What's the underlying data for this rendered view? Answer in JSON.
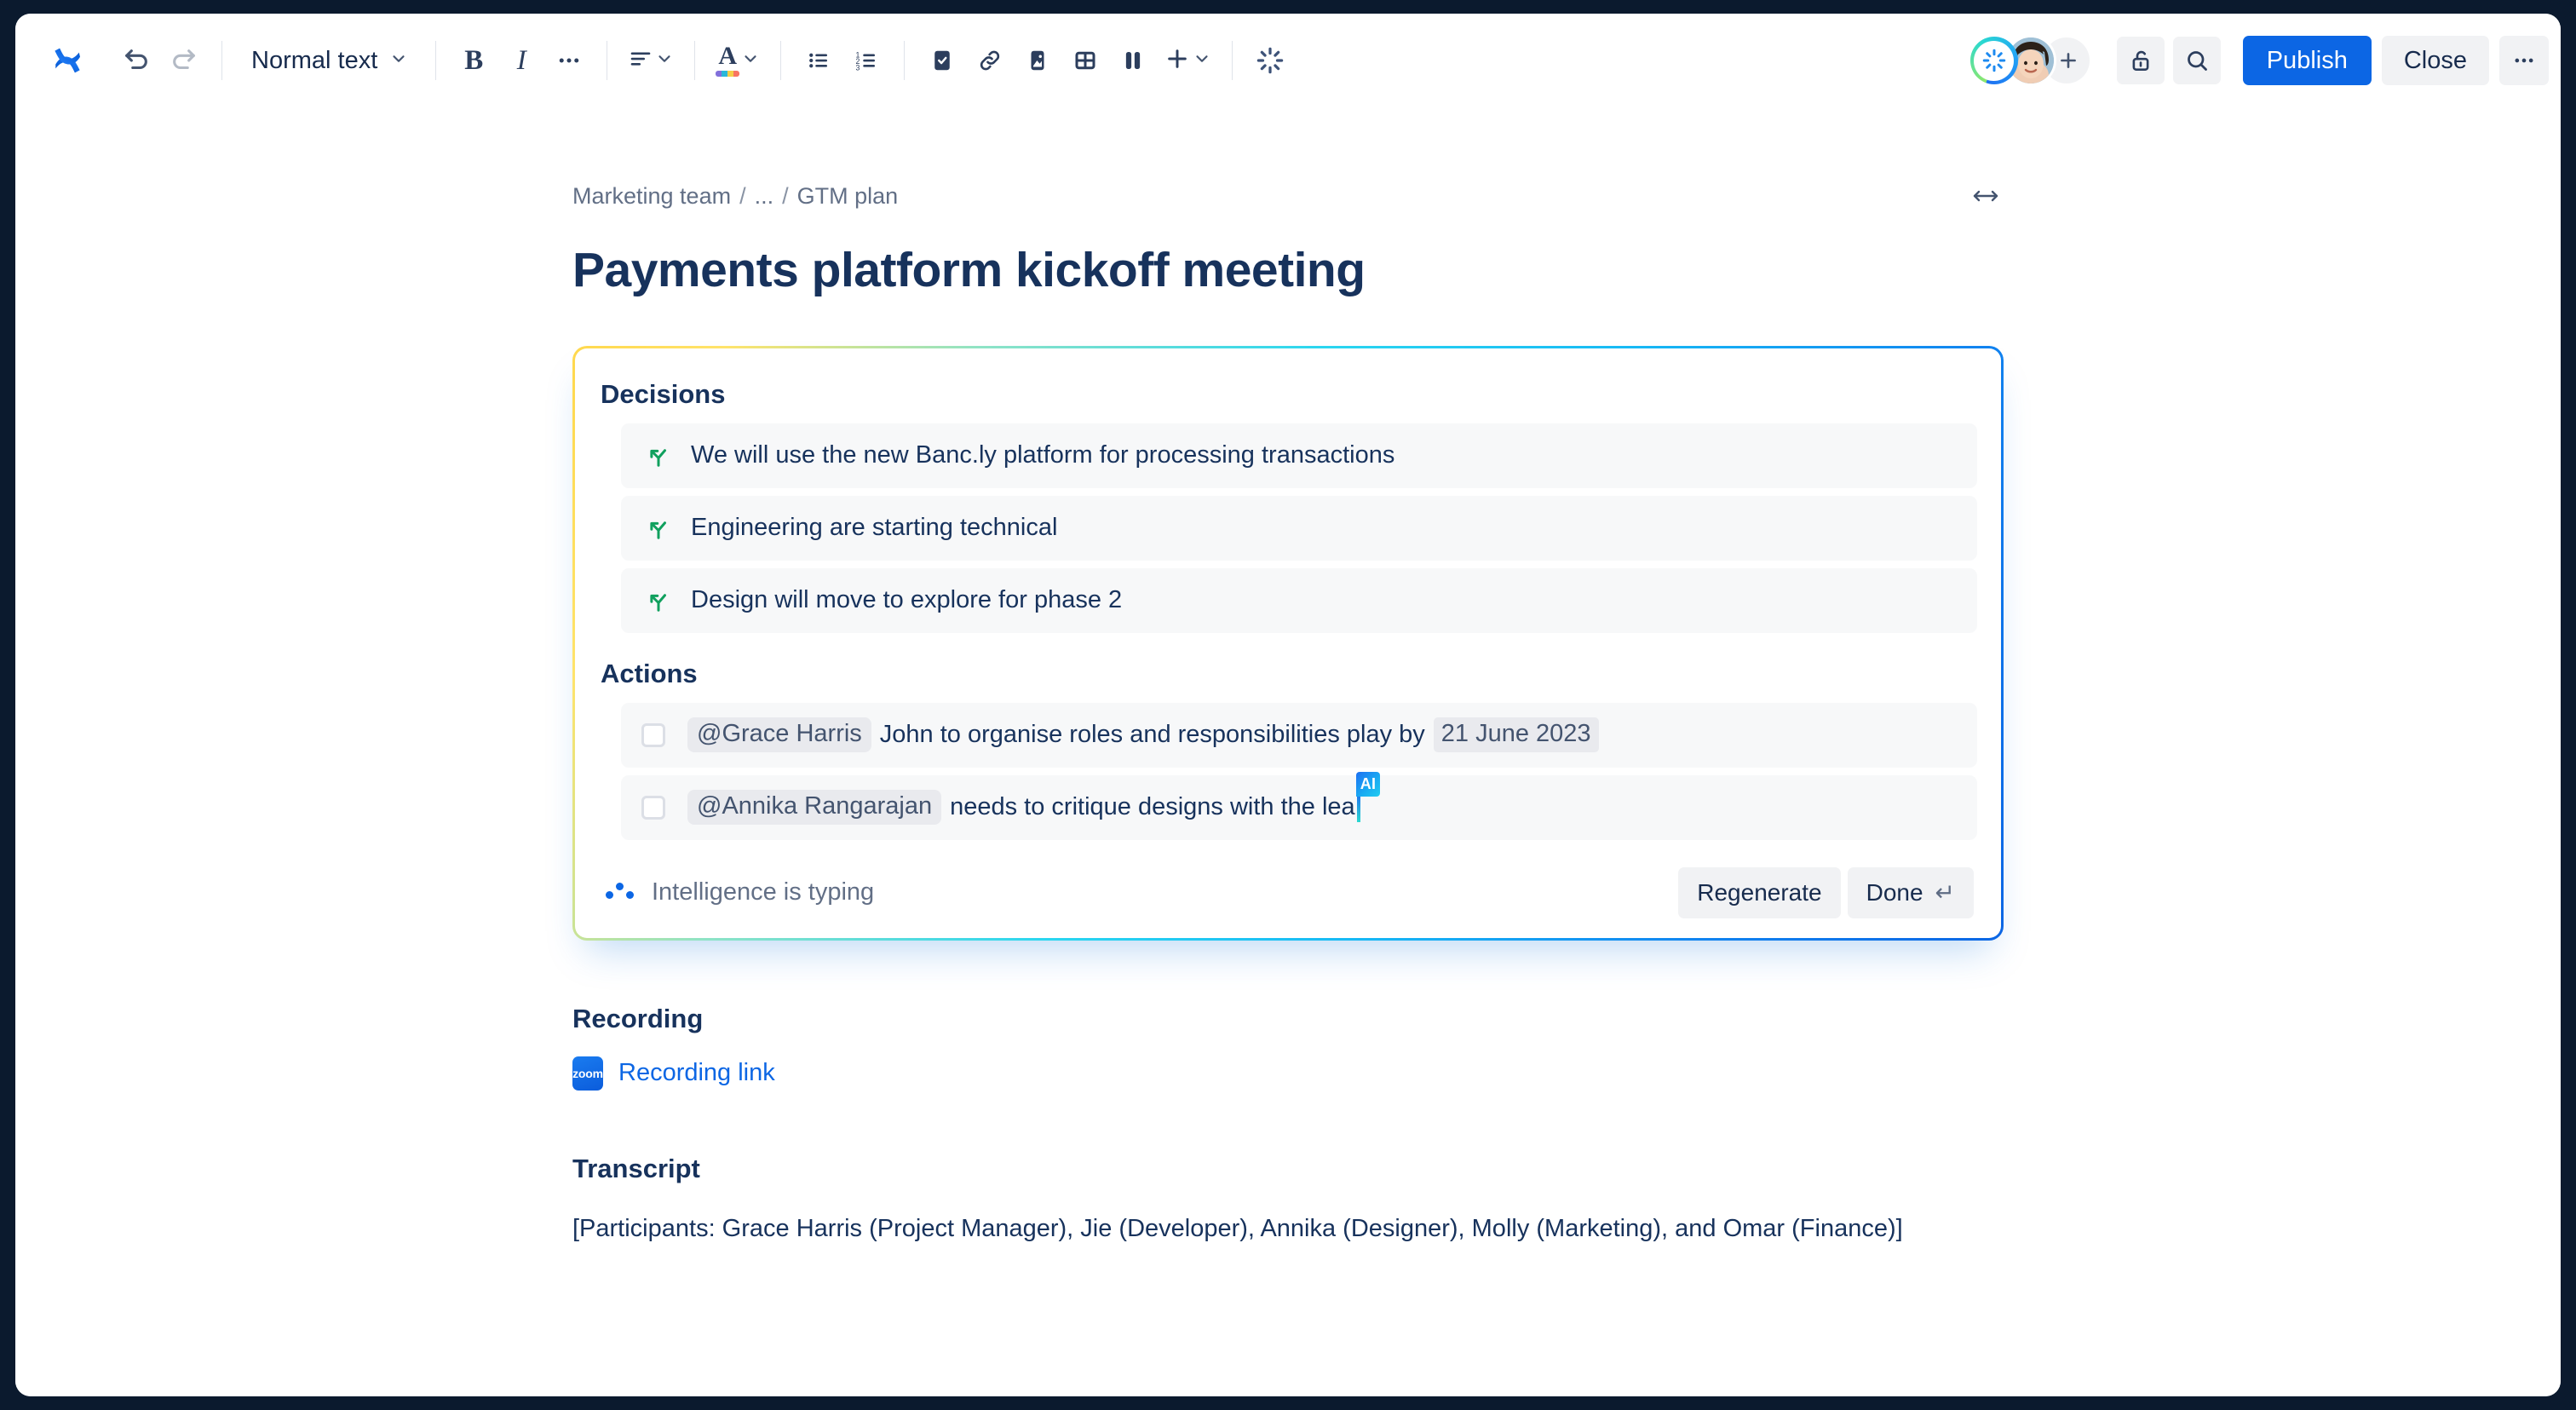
{
  "toolbar": {
    "logo_icon": "atlassian-confluence-logo-icon",
    "undo_icon": "undo-icon",
    "redo_icon": "redo-icon",
    "text_style_label": "Normal text",
    "text_style_chevron_icon": "chevron-down-icon",
    "bold_label": "B",
    "italic_label": "I",
    "more_formatting_icon": "ellipsis-icon",
    "align_icon": "text-align-left-icon",
    "align_chevron_icon": "chevron-down-icon",
    "text_color_label": "A",
    "text_color_chevron_icon": "chevron-down-icon",
    "bullet_list_icon": "bullet-list-icon",
    "numbered_list_icon": "numbered-list-icon",
    "task_icon": "task-checkbox-icon",
    "link_icon": "link-icon",
    "image_icon": "image-icon",
    "table_icon": "table-icon",
    "layout_icon": "columns-layout-icon",
    "insert_icon": "plus-icon",
    "insert_chevron_icon": "chevron-down-icon",
    "ai_icon": "atlassian-intelligence-sparkle-icon",
    "presence_ai_icon": "atlassian-intelligence-avatar-icon",
    "presence_user_avatar": "user-avatar",
    "presence_add_icon": "plus-icon",
    "restrictions_icon": "unlocked-padlock-icon",
    "search_icon": "search-icon",
    "publish_label": "Publish",
    "close_label": "Close",
    "more_actions_icon": "ellipsis-icon"
  },
  "breadcrumb": {
    "items": [
      "Marketing team",
      "...",
      "GTM plan"
    ],
    "separator": "/",
    "width_toggle_icon": "full-width-toggle-icon"
  },
  "page": {
    "title": "Payments platform kickoff meeting"
  },
  "ai_panel": {
    "decisions_heading": "Decisions",
    "decision_icon": "decision-fork-icon",
    "decisions": [
      "We will use the new Banc.ly platform for processing transactions",
      "Engineering are starting technical",
      "Design will move to explore for phase 2"
    ],
    "actions_heading": "Actions",
    "actions": [
      {
        "checkbox_icon": "unchecked-checkbox-icon",
        "mention": "@Grace Harris",
        "text": "John to organise roles and responsibilities play by",
        "date": "21 June 2023",
        "typing": false
      },
      {
        "checkbox_icon": "unchecked-checkbox-icon",
        "mention": "@Annika Rangarajan",
        "text": "needs to critique designs with the lea",
        "date": "",
        "typing": true,
        "caret_badge": "AI"
      }
    ],
    "status_icon": "typing-dots-icon",
    "status_label": "Intelligence is typing",
    "regenerate_label": "Regenerate",
    "done_label": "Done",
    "done_shortcut_icon": "enter-key-icon"
  },
  "recording": {
    "heading": "Recording",
    "app_icon": "zoom-logo-icon",
    "app_icon_label": "zoom",
    "link_label": "Recording link"
  },
  "transcript": {
    "heading": "Transcript",
    "body": "[Participants: Grace Harris (Project Manager), Jie (Developer),  Annika (Designer), Molly (Marketing), and  Omar (Finance)]"
  },
  "colors": {
    "brand_blue": "#0c66e4",
    "text_dark": "#17325c",
    "muted_text": "#626f86",
    "panel_row_bg": "#f7f8f9",
    "ai_gradient_start": "#ffd84d",
    "ai_gradient_mid": "#2ad6f0",
    "ai_gradient_end": "#0c66e4",
    "decision_green": "#10a05e"
  }
}
